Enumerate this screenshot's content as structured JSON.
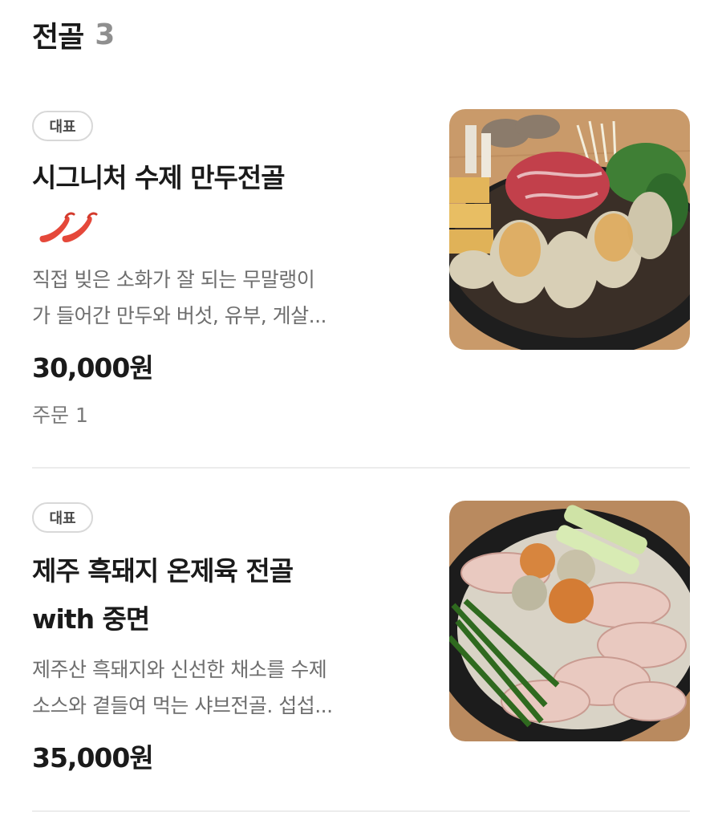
{
  "section": {
    "title": "전골",
    "count": "3"
  },
  "items": [
    {
      "badge": "대표",
      "name": "시그니처 수제 만두전골",
      "spicy_level": 2,
      "spicy_icon": "chili-pepper-icon",
      "desc_line1": "직접 빚은 소화가 잘 되는 무말랭이",
      "desc_line2": "가 들어간 만두와 버섯, 유부, 게살...",
      "price": "30,000원",
      "orders": "주문 1"
    },
    {
      "badge": "대표",
      "name_line1": "제주 흑돼지 온제육 전골",
      "name_line2": "with 중면",
      "desc_line1": "제주산 흑돼지와 신선한 채소를 수제",
      "desc_line2": "소스와 곁들여 먹는 샤브전골. 섭섭...",
      "price": "35,000원"
    }
  ],
  "colors": {
    "title": "#1a1a1a",
    "count": "#8f8f8f",
    "description": "#6e6e6e",
    "badge_border": "#d8d8d8",
    "spicy": "#e5483a",
    "divider": "#ececec"
  }
}
